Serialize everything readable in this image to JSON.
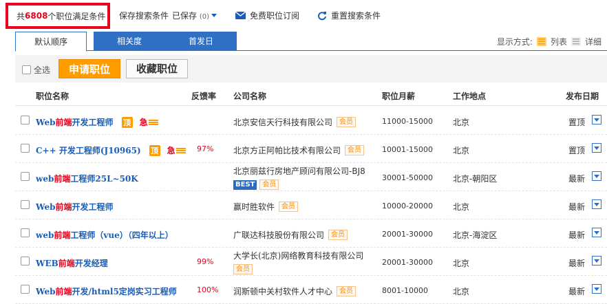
{
  "summary": {
    "prefix": "共",
    "count": "6808",
    "suffix": "个职位满足条件"
  },
  "toolbar": {
    "save_search": "保存搜索条件",
    "saved_label": "已保存",
    "saved_count": "(0)",
    "subscribe": "免费职位订阅",
    "reset": "重置搜索条件"
  },
  "tabs": [
    "默认顺序",
    "相关度",
    "首发日"
  ],
  "display_mode": {
    "label": "显示方式:",
    "list": "列表",
    "detail": "详细"
  },
  "actions": {
    "select_all": "全选",
    "apply": "申请职位",
    "favorite": "收藏职位"
  },
  "columns": [
    "职位名称",
    "反馈率",
    "公司名称",
    "职位月薪",
    "工作地点",
    "发布日期"
  ],
  "tags": {
    "top": "顶",
    "urgent": "急",
    "member": "会员",
    "best": "BEST"
  },
  "colors": {
    "accent": "#2f6fc4",
    "highlight": "#e8001c",
    "orange": "#ff9c00"
  },
  "rows": [
    {
      "pre": "Web",
      "kw": "前端",
      "post": "开发工程师",
      "feedback": "",
      "company": "北京安信天行科技有限公司",
      "salary": "11000-15000",
      "location": "北京",
      "date": "置顶"
    },
    {
      "pre": "C++ ",
      "kw": "",
      "post": "开发工程师(J10965)",
      "feedback": "97%",
      "company": "北京方正阿帕比技术有限公司",
      "salary": "10001-15000",
      "location": "北京",
      "date": "置顶"
    },
    {
      "pre": "web",
      "kw": "前端",
      "post": "工程师25L~50K",
      "feedback": "",
      "company": "北京丽兹行房地产顾问有限公司-BJ8",
      "salary": "30001-50000",
      "location": "北京-朝阳区",
      "date": "最新"
    },
    {
      "pre": "Web",
      "kw": "前端",
      "post": "开发工程师",
      "feedback": "",
      "company": "赢时胜软件",
      "salary": "10000-20000",
      "location": "北京",
      "date": "最新"
    },
    {
      "pre": "web",
      "kw": "前端",
      "post": "工程师（vue）（四年以上）",
      "feedback": "",
      "company": "广联达科技股份有限公司",
      "salary": "20001-30000",
      "location": "北京-海淀区",
      "date": "最新"
    },
    {
      "pre": "WEB",
      "kw": "前端",
      "post": "开发经理",
      "feedback": "99%",
      "company": "大学长(北京)网络教育科技有限公司",
      "salary": "20001-30000",
      "location": "北京",
      "date": "最新"
    },
    {
      "pre": "Web",
      "kw": "前端",
      "post": "开发/html5定岗实习工程师",
      "feedback": "100%",
      "company": "润斯顿中关村软件人才中心",
      "salary": "8001-10000",
      "location": "北京",
      "date": "最新"
    }
  ]
}
